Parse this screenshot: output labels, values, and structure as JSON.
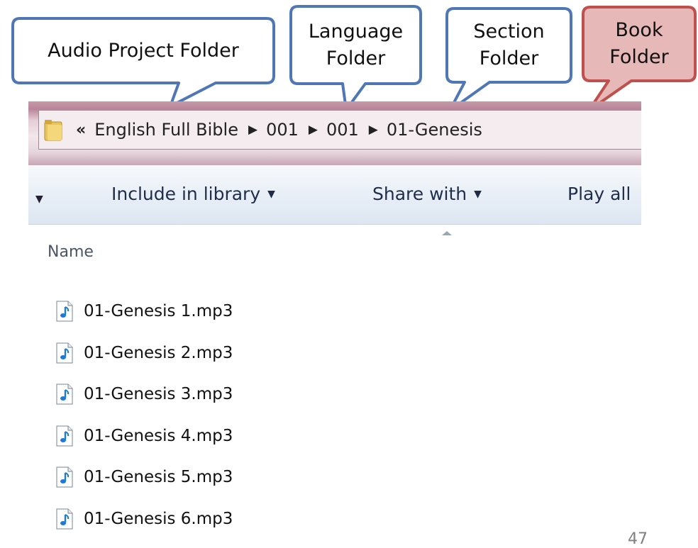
{
  "callouts": {
    "audio_project": "Audio Project Folder",
    "language": "Language\nFolder",
    "section": "Section\nFolder",
    "book": "Book\nFolder"
  },
  "colors": {
    "callout_border_blue": "#4f76b5",
    "callout_fill_book": "#e6b8b8",
    "callout_border_red": "#c0504d"
  },
  "address_bar": {
    "overflow_glyph": "«",
    "crumbs": [
      "English Full Bible",
      "001",
      "001",
      "01-Genesis"
    ],
    "separator": "▶"
  },
  "toolbar": {
    "include_in_library": "Include in library",
    "share_with": "Share with",
    "play_all": "Play all",
    "dropdown_glyph": "▼"
  },
  "file_list": {
    "column_header": "Name",
    "files": [
      "01-Genesis 1.mp3",
      "01-Genesis 2.mp3",
      "01-Genesis 3.mp3",
      "01-Genesis 4.mp3",
      "01-Genesis 5.mp3",
      "01-Genesis 6.mp3"
    ],
    "file_icon": "audio-file-icon"
  },
  "page_number": "47"
}
